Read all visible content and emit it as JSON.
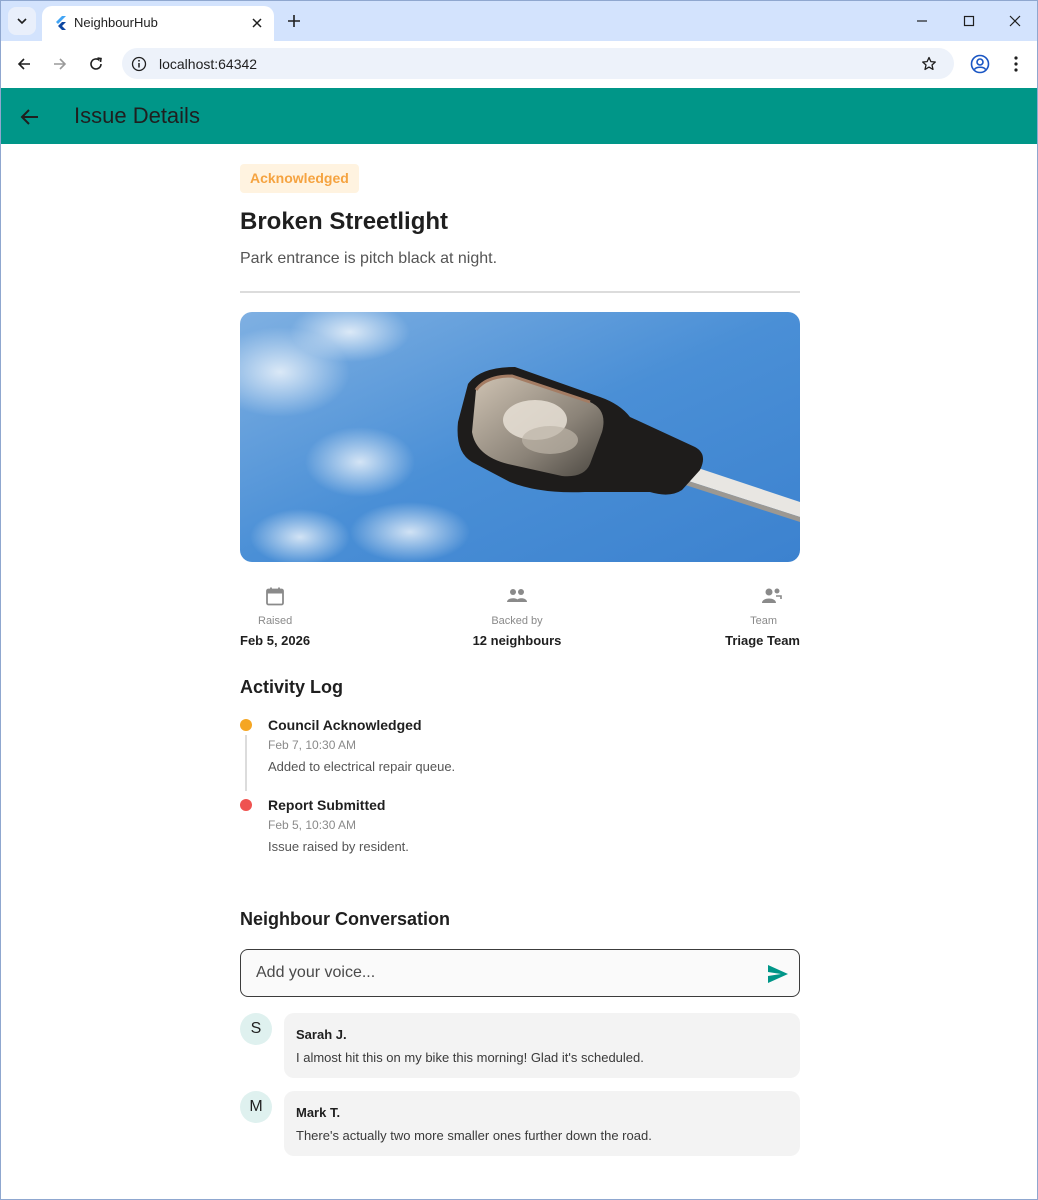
{
  "browser": {
    "tab_title": "NeighbourHub",
    "url": "localhost:64342"
  },
  "appbar": {
    "title": "Issue Details"
  },
  "issue": {
    "status": "Acknowledged",
    "status_color": "#f5a340",
    "title": "Broken Streetlight",
    "description": "Park entrance is pitch black at night.",
    "stats": [
      {
        "icon": "calendar-icon",
        "label": "Raised",
        "value": "Feb 5, 2026"
      },
      {
        "icon": "people-icon",
        "label": "Backed by",
        "value": "12 neighbours"
      },
      {
        "icon": "team-icon",
        "label": "Team",
        "value": "Triage Team"
      }
    ]
  },
  "activity": {
    "title": "Activity Log",
    "items": [
      {
        "title": "Council Acknowledged",
        "time": "Feb 7, 10:30 AM",
        "desc": "Added to electrical repair queue.",
        "color": "#f5a623"
      },
      {
        "title": "Report Submitted",
        "time": "Feb 5, 10:30 AM",
        "desc": "Issue raised by resident.",
        "color": "#ef5350"
      }
    ]
  },
  "conversation": {
    "title": "Neighbour Conversation",
    "placeholder": "Add your voice...",
    "comments": [
      {
        "initial": "S",
        "author": "Sarah J.",
        "text": "I almost hit this on my bike this morning! Glad it's scheduled."
      },
      {
        "initial": "M",
        "author": "Mark T.",
        "text": "There's actually two more smaller ones further down the road."
      }
    ]
  },
  "theme": {
    "primary": "#009688"
  }
}
